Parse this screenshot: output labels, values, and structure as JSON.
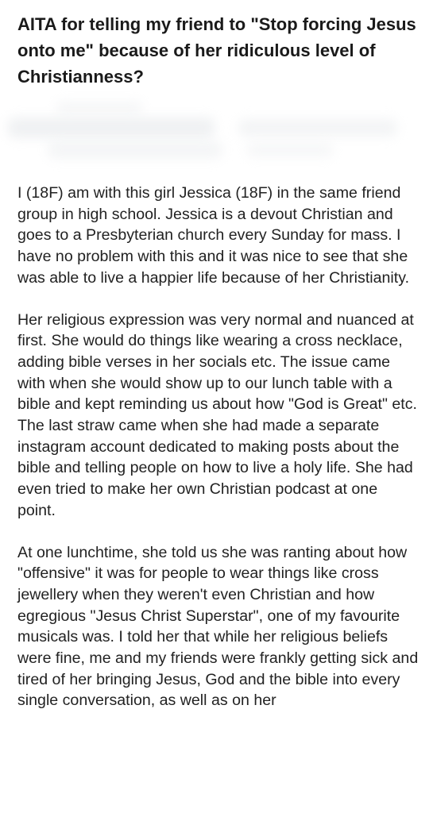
{
  "post": {
    "title": "AITA for telling my friend to \"Stop forcing Jesus onto me\" because of her ridiculous level of Christianness?",
    "paragraphs": [
      "I (18F) am with this girl Jessica (18F) in the same friend group in high school. Jessica is a devout Christian and goes to a Presbyterian church every Sunday for mass. I have no problem with this and it was nice to see that she was able to live a happier life because of her Christianity.",
      "Her religious expression was very normal and nuanced at first. She would do things like wearing a cross necklace, adding bible verses in her socials etc. The issue came with when she would show up to our lunch table with a bible and kept reminding us about how \"God is Great\" etc. The last straw came when she had made a separate instagram account dedicated to making posts about the bible and telling people on how to live a holy life. She had even tried to make her own Christian podcast at one point.",
      "At one lunchtime, she told us she was ranting about how \"offensive\" it was for people to wear things like cross jewellery when they weren't even Christian and how egregious \"Jesus Christ Superstar\", one of my favourite musicals was. I told her that while her religious beliefs were fine, me and my friends were frankly getting sick and tired of her bringing Jesus, God and the bible into every single conversation, as well as on her"
    ]
  }
}
